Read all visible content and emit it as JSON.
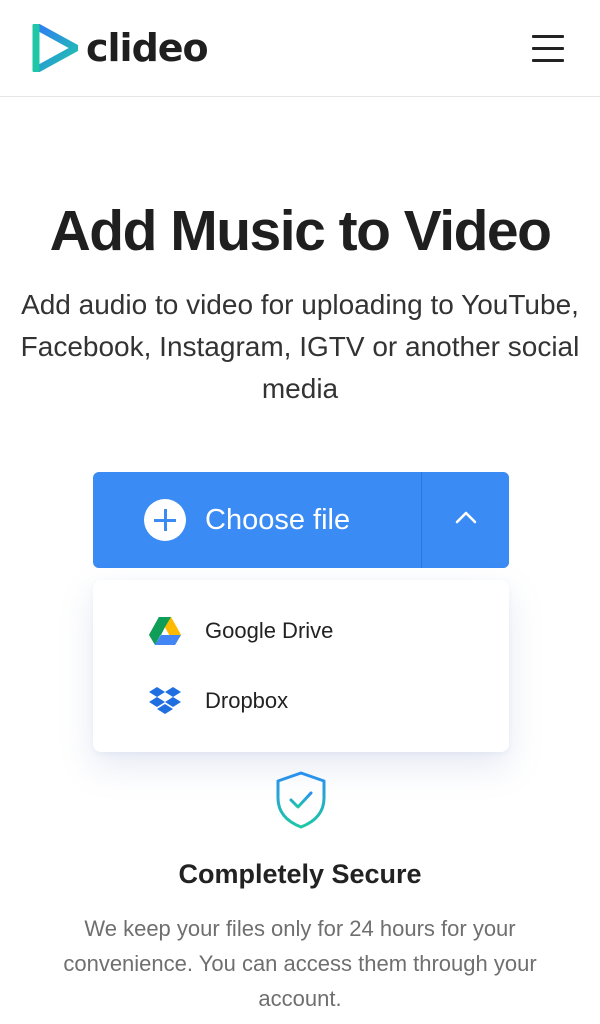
{
  "header": {
    "logo_text": "clideo",
    "logo_icon": "clideo-play-triangle-icon",
    "menu_icon": "hamburger-menu-icon"
  },
  "hero": {
    "title": "Add Music to Video",
    "subtitle": "Add audio to video for uploading to YouTube, Facebook, Instagram, IGTV or another social media"
  },
  "upload": {
    "choose_label": "Choose file",
    "plus_icon": "plus-circle-icon",
    "toggle_icon": "chevron-up-icon",
    "dropdown_expanded": true,
    "sources": [
      {
        "label": "Google Drive",
        "icon": "google-drive-icon"
      },
      {
        "label": "Dropbox",
        "icon": "dropbox-icon"
      }
    ]
  },
  "security": {
    "icon": "shield-check-icon",
    "title": "Completely Secure",
    "text": "We keep your files only for 24 hours for your convenience. You can access them through your account."
  },
  "colors": {
    "primary_button": "#3a8bf4",
    "logo_teal": "#1fc7a7",
    "logo_blue": "#2f7bf5",
    "shield_teal": "#1fbfa3"
  }
}
